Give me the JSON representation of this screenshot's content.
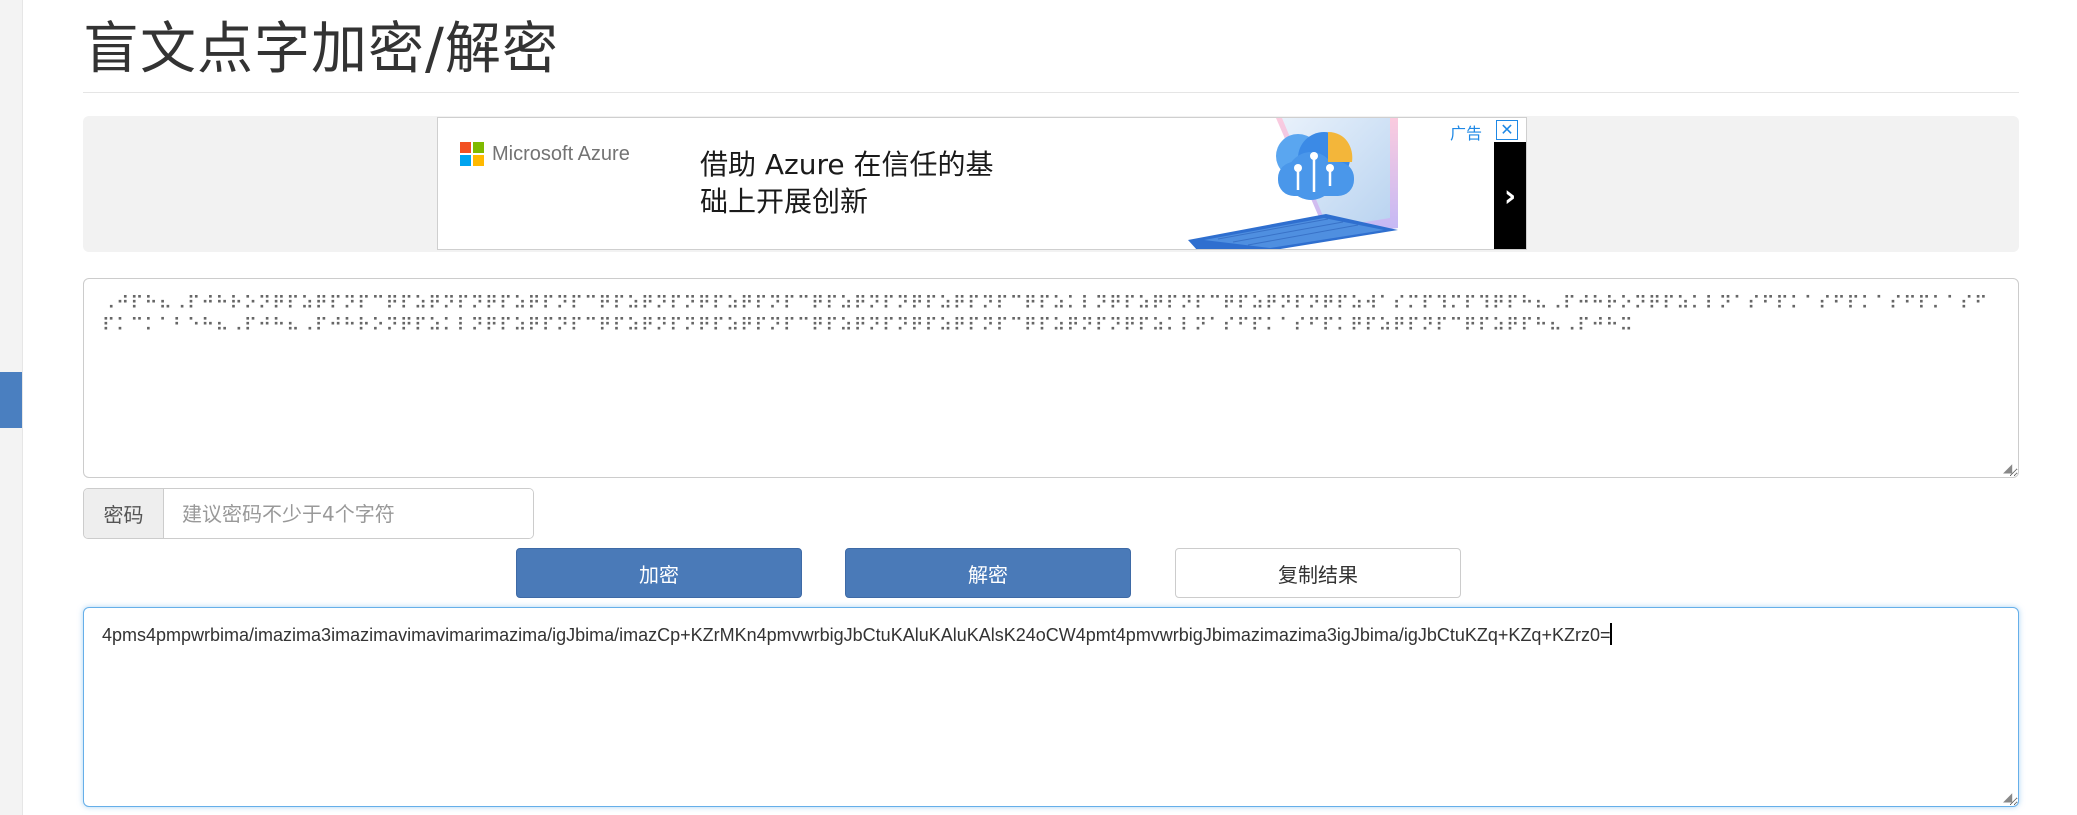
{
  "page": {
    "title": "盲文点字加密/解密"
  },
  "ad": {
    "brand": "Microsoft Azure",
    "headline_line1": "借助 Azure 在信任的基",
    "headline_line2": "础上开展创新",
    "label": "广告",
    "close_glyph": "✕",
    "next_glyph": "›"
  },
  "input": {
    "value": "⠠⠚⠏⠓⠦⠠⠏⠚⠓⠗⠕⠝⠟⠏⠵⠟⠏⠝⠏⠉⠟⠏⠵⠟⠝⠏⠝⠟⠏⠵⠟⠏⠝⠏⠉⠟⠏⠵⠟⠝⠏⠝⠟⠏⠵⠟⠏⠝⠏⠉⠟⠏⠵⠟⠝⠏⠝⠟⠏⠵⠟⠏⠝⠏⠉⠟⠏⠵⠅⠇⠝⠟⠏⠵⠟⠏⠝⠏⠉⠟⠏⠵⠟⠝⠏⠝⠟⠏⠵⠺⠁⠎⠍⠏⠹⠍⠏⠹⠟⠏⠓⠦⠠⠏⠚⠓⠗⠕⠝⠟⠏⠵⠅⠇⠝⠁⠎⠋⠏⠅⠁⠎⠋⠏⠅⠁⠎⠋⠏⠅⠁⠎⠋⠏⠅⠉⠅⠁⠃⠑⠓⠦⠠⠏⠚⠓⠦⠠⠏⠚⠓⠗⠕⠝⠟⠏⠵⠅⠇⠝⠟⠏⠵⠟⠏⠝⠏⠉⠟⠏⠵⠟⠝⠏⠝⠟⠏⠵⠟⠏⠝⠏⠉⠟⠏⠵⠟⠝⠏⠝⠟⠏⠵⠟⠏⠝⠏⠉⠟⠏⠵⠟⠝⠏⠝⠟⠏⠵⠅⠇⠝⠁⠎⠋⠏⠅⠁⠎⠋⠏⠅⠟⠏⠵⠟⠏⠝⠏⠉⠟⠏⠵⠟⠏⠓⠦⠠⠏⠚⠓⠭"
  },
  "password": {
    "label": "密码",
    "placeholder": "建议密码不少于4个字符",
    "value": ""
  },
  "buttons": {
    "encrypt": "加密",
    "decrypt": "解密",
    "copy": "复制结果"
  },
  "output": {
    "value": "4pms4pmpwrbima/imazima3imazimavimavimarimazima/igJbima/imazCp+KZrMKn4pmvwrbigJbCtuKAluKAluKAlsK24oCW4pmt4pmvwrbigJbimazimazima3igJbima/igJbCtuKZq+KZq+KZrz0="
  },
  "colors": {
    "primary": "#4a7ab8",
    "focus_border": "#66afe9",
    "left_tab": "#4a7fc0",
    "ms_red": "#f25022",
    "ms_green": "#7fba00",
    "ms_blue": "#00a4ef",
    "ms_yellow": "#ffb900"
  }
}
